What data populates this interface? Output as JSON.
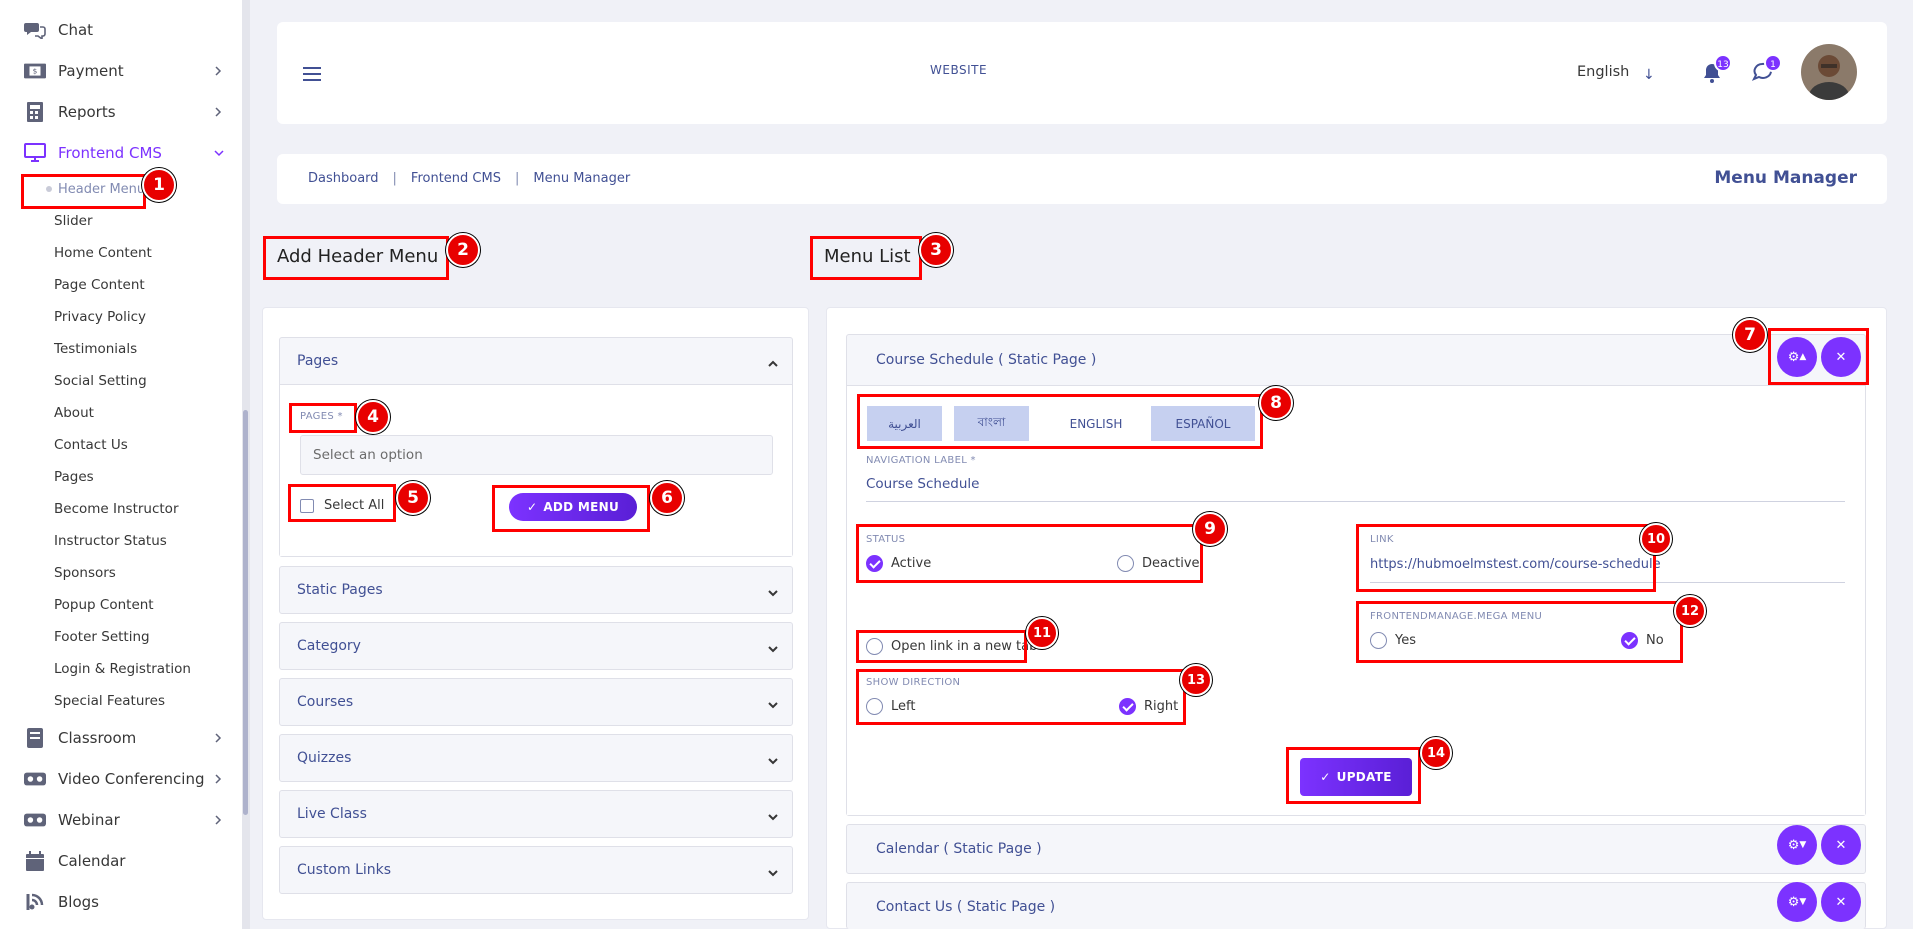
{
  "sidebar": {
    "items": [
      {
        "label": "Chat",
        "icon": "chat-icon"
      },
      {
        "label": "Payment",
        "icon": "payment-icon"
      },
      {
        "label": "Reports",
        "icon": "calculator-icon"
      },
      {
        "label": "Frontend CMS",
        "icon": "monitor-icon"
      }
    ],
    "submenu": [
      "Header Menu",
      "Slider",
      "Home Content",
      "Page Content",
      "Privacy Policy",
      "Testimonials",
      "Social Setting",
      "About",
      "Contact Us",
      "Pages",
      "Become Instructor",
      "Instructor Status",
      "Sponsors",
      "Popup Content",
      "Footer Setting",
      "Login & Registration",
      "Special Features"
    ],
    "bottom_items": [
      {
        "label": "Classroom",
        "icon": "classroom-icon"
      },
      {
        "label": "Video Conferencing",
        "icon": "vr-icon"
      },
      {
        "label": "Webinar",
        "icon": "vr-icon"
      },
      {
        "label": "Calendar",
        "icon": "calendar-icon"
      },
      {
        "label": "Blogs",
        "icon": "blog-icon"
      }
    ]
  },
  "header": {
    "website": "WEBSITE",
    "language": "English",
    "notifications_count": "13",
    "messages_count": "1"
  },
  "breadcrumb": {
    "items": [
      "Dashboard",
      "Frontend CMS",
      "Menu Manager"
    ],
    "title": "Menu Manager"
  },
  "left": {
    "title": "Add Header Menu",
    "pages_section": "Pages",
    "pages_label": "PAGES *",
    "select_placeholder": "Select an option",
    "select_all": "Select All",
    "add_menu": "ADD MENU",
    "sections": [
      "Static Pages",
      "Category",
      "Courses",
      "Quizzes",
      "Live Class",
      "Custom Links"
    ]
  },
  "right": {
    "title": "Menu List",
    "cards": [
      "Course Schedule ( Static Page )",
      "Calendar ( Static Page )",
      "Contact Us ( Static Page )"
    ],
    "lang_tabs": [
      "العربية",
      "বাংলা",
      "ENGLISH",
      "ESPAÑOL"
    ],
    "nav_label": "NAVIGATION LABEL *",
    "nav_value": "Course Schedule",
    "status_label": "STATUS",
    "status_active": "Active",
    "status_deactive": "Deactive",
    "link_label": "LINK",
    "link_value": "https://hubmoelmstest.com/course-schedule",
    "new_tab": "Open link in a new tab",
    "mega_label": "FRONTENDMANAGE.MEGA MENU",
    "mega_yes": "Yes",
    "mega_no": "No",
    "direction_label": "SHOW DIRECTION",
    "dir_left": "Left",
    "dir_right": "Right",
    "update": "UPDATE"
  },
  "annotations": [
    "1",
    "2",
    "3",
    "4",
    "5",
    "6",
    "7",
    "8",
    "9",
    "10",
    "11",
    "12",
    "13",
    "14"
  ],
  "colors": {
    "accent": "#7c32ff",
    "highlight": "#ff0000",
    "text_blue": "#415094"
  }
}
